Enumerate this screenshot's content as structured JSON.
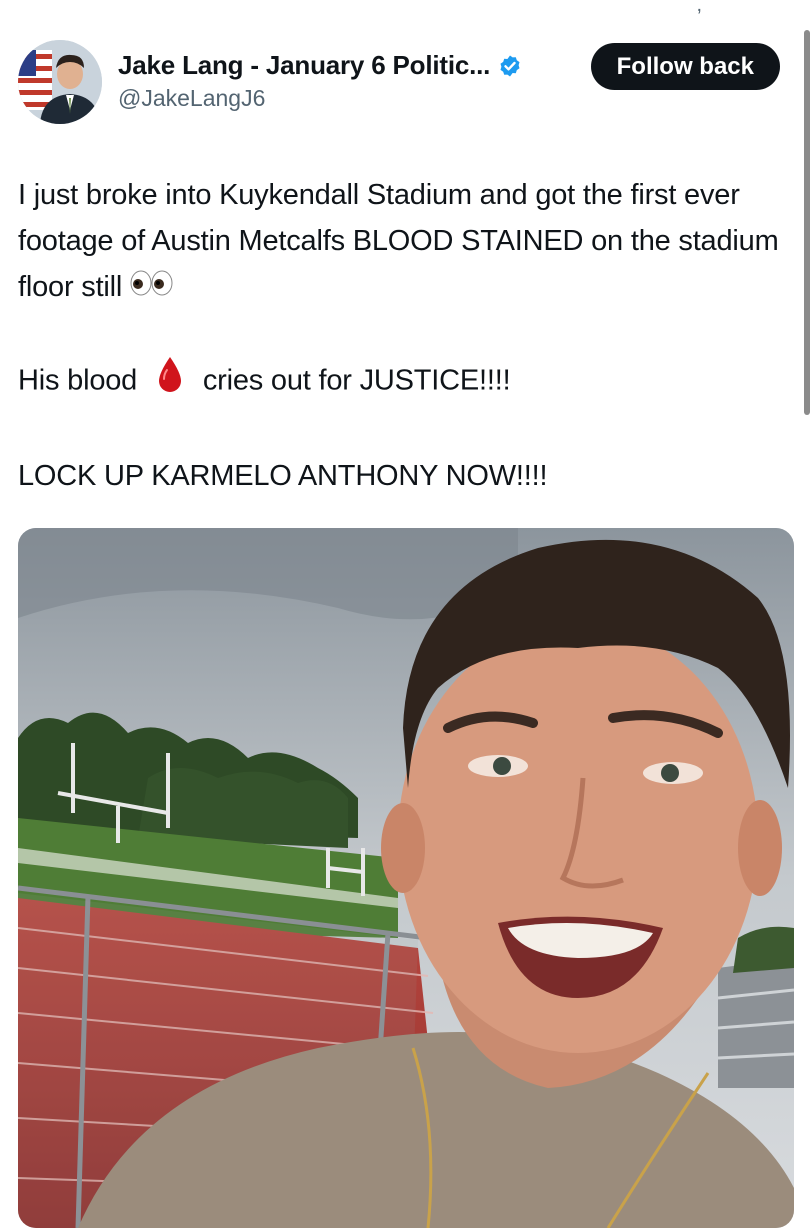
{
  "tweet": {
    "author": {
      "display_name": "Jake Lang - January 6 Politic...",
      "handle": "@JakeLangJ6",
      "verified": true,
      "avatar_icon": "user-avatar-with-flag"
    },
    "follow_button_label": "Follow back",
    "text": {
      "line1": "I just broke into Kuykendall Stadium and got the first ever footage of Austin Metcalfs BLOOD STAINED on the stadium floor still",
      "line2_before": "His blood",
      "line2_after": "cries out for JUSTICE!!!!",
      "line3": "LOCK UP KARMELO ANTHONY NOW!!!!"
    },
    "emojis": [
      "eyes-emoji",
      "blood-drop-emoji"
    ],
    "media_icon": "video-thumbnail-selfie-stadium"
  },
  "colors": {
    "text": "#0f1419",
    "secondary": "#536471",
    "verified_blue": "#1d9bf0",
    "button_bg": "#0f1419",
    "track_red": "#a8393a"
  }
}
